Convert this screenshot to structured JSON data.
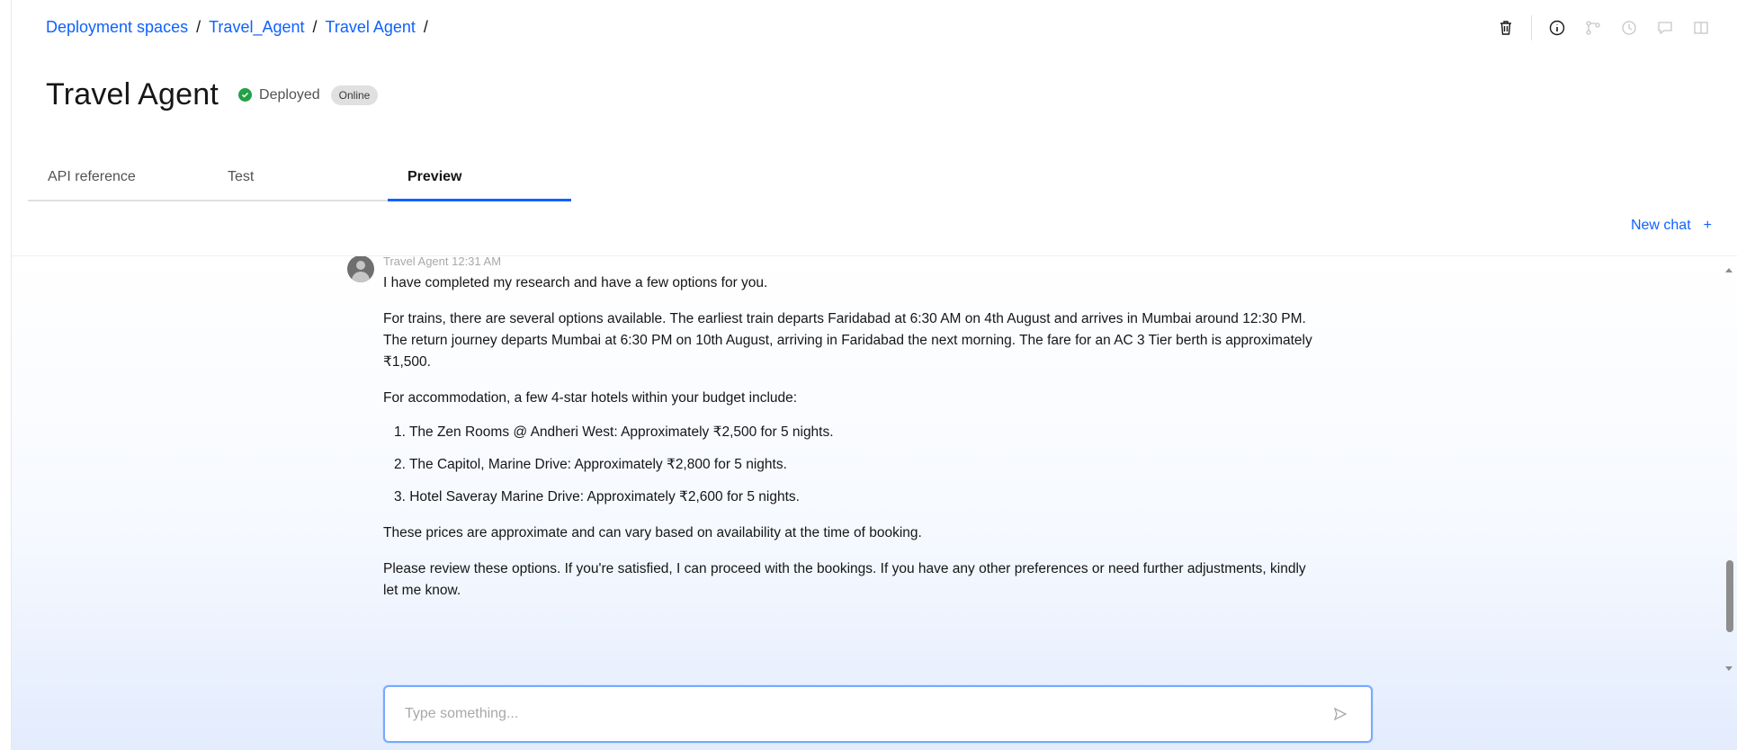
{
  "breadcrumb": {
    "items": [
      "Deployment spaces",
      "Travel_Agent",
      "Travel Agent"
    ],
    "separator": "/"
  },
  "toolbar": {
    "icons": [
      "trash-icon",
      "info-icon",
      "branch-icon",
      "history-icon",
      "chat-icon",
      "split-icon"
    ]
  },
  "header": {
    "title": "Travel Agent",
    "status": "Deployed",
    "badge": "Online"
  },
  "tabs": [
    {
      "label": "API reference",
      "active": false
    },
    {
      "label": "Test",
      "active": false
    },
    {
      "label": "Preview",
      "active": true
    }
  ],
  "new_chat": {
    "label": "New chat",
    "icon": "+"
  },
  "message": {
    "sender_meta": "Travel Agent 12:31 AM",
    "intro": "I have completed my research and have a few options for you.",
    "trains": "For trains, there are several options available. The earliest train departs Faridabad at 6:30 AM on 4th August and arrives in Mumbai around 12:30 PM. The return journey departs Mumbai at 6:30 PM on 10th August, arriving in Faridabad the next morning. The fare for an AC 3 Tier berth is approximately ₹1,500.",
    "accommodation_intro": "For accommodation, a few 4-star hotels within your budget include:",
    "hotels": [
      "1. The Zen Rooms @ Andheri West: Approximately ₹2,500 for 5 nights.",
      "2. The Capitol, Marine Drive: Approximately ₹2,800 for 5 nights.",
      "3. Hotel Saveray Marine Drive: Approximately ₹2,600 for 5 nights."
    ],
    "disclaimer": "These prices are approximate and can vary based on availability at the time of booking.",
    "closing": "Please review these options. If you're satisfied, I can proceed with the bookings. If you have any other preferences or need further adjustments, kindly let me know."
  },
  "input": {
    "placeholder": "Type something...",
    "value": ""
  },
  "colors": {
    "link": "#0f62fe",
    "status_green": "#24a148",
    "input_border": "#78a9ff"
  }
}
